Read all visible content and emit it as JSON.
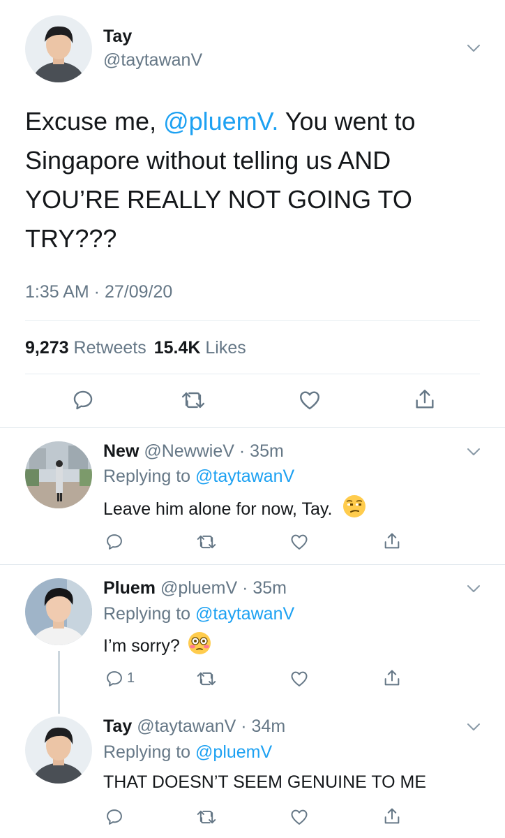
{
  "main_tweet": {
    "author_name": "Tay",
    "author_handle": "@taytawanV",
    "text_part1": "Excuse me, ",
    "mention": "@pluemV.",
    "text_part2": " You went to Singapore without telling us AND YOU’RE REALLY NOT GOING TO TRY???",
    "timestamp": "1:35 AM · 27/09/20",
    "retweet_count": "9,273",
    "retweets_label": "Retweets",
    "like_count": "15.4K",
    "likes_label": "Likes"
  },
  "replies": [
    {
      "name": "New",
      "handle": "@NewwieV",
      "time": "· 35m",
      "replying_label": "Replying to ",
      "replying_to": "@taytawanV",
      "text": "Leave him alone for now, Tay.",
      "emoji": "unamused-face",
      "reply_count": ""
    },
    {
      "name": "Pluem",
      "handle": "@pluemV",
      "time": "· 35m",
      "replying_label": "Replying to ",
      "replying_to": "@taytawanV",
      "text": "I’m sorry?",
      "emoji": "flushed-face",
      "reply_count": "1"
    },
    {
      "name": "Tay",
      "handle": "@taytawanV",
      "time": "· 34m",
      "replying_label": "Replying to ",
      "replying_to": "@pluemV",
      "text": "THAT DOESN’T SEEM GENUINE TO ME",
      "reply_count": ""
    }
  ],
  "colors": {
    "accent": "#1da1f2",
    "muted": "#657786",
    "divider": "#e1e8ed",
    "text": "#14171a"
  }
}
